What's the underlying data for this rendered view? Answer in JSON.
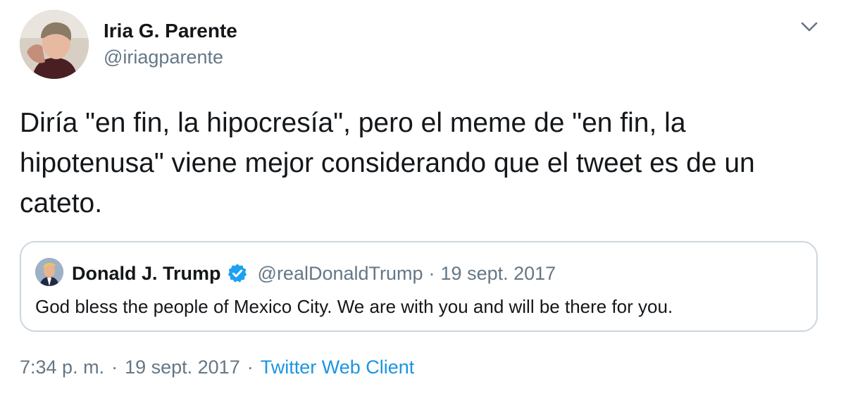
{
  "author": {
    "name": "Iria G. Parente",
    "handle": "@iriagparente",
    "avatar_icon": "profile-photo"
  },
  "tweet": {
    "text": "Diría \"en fin, la hipocresía\", pero el meme de \"en fin, la hipotenusa\" viene mejor considerando que el tweet es de un cateto."
  },
  "quoted_tweet": {
    "name": "Donald J. Trump",
    "verified": true,
    "handle": "@realDonaldTrump",
    "separator": "·",
    "date": "19 sept. 2017",
    "text": "God bless the people of Mexico City. We are with you and will be there for you."
  },
  "meta": {
    "time": "7:34 p. m.",
    "separator": "·",
    "date": "19 sept. 2017",
    "source": "Twitter Web Client"
  },
  "colors": {
    "text_primary": "#14171a",
    "text_secondary": "#657786",
    "accent": "#1b95e0",
    "verified": "#1da1f2",
    "border": "#ccd6dd"
  },
  "icons": {
    "menu": "chevron-down-icon",
    "verified": "verified-badge-icon"
  }
}
